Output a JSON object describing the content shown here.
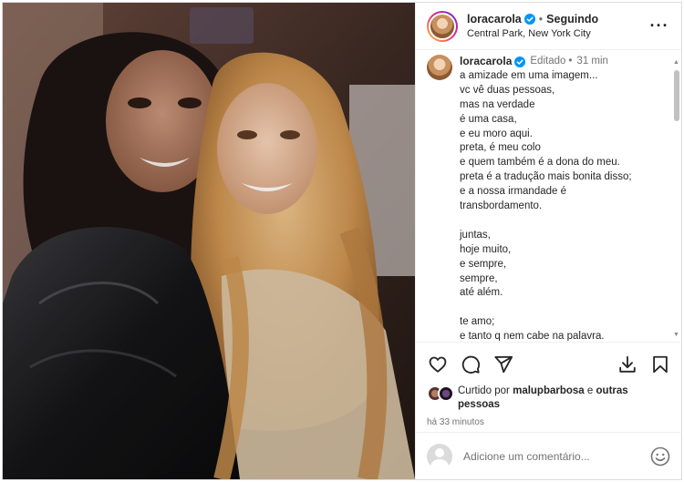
{
  "post": {
    "username": "loracarola",
    "follow_status": "Seguindo",
    "separator": "•",
    "location": "Central Park, New York City",
    "more_label": "···"
  },
  "caption": {
    "username": "loracarola",
    "edited_label": "Editado",
    "separator": "•",
    "time": "31 min",
    "lines": [
      "a amizade em uma imagem...",
      "vc vê duas pessoas,",
      "mas na verdade",
      "é uma casa,",
      "e eu moro aqui.",
      "preta, é meu colo",
      "e quem também é a dona do meu.",
      "preta é a tradução mais bonita disso;",
      "e a nossa irmandade é",
      "transbordamento.",
      "",
      "juntas,",
      "hoje muito,",
      "e sempre,",
      "sempre,",
      "até além.",
      "",
      "te amo;",
      "e tanto q nem cabe na palavra."
    ]
  },
  "likes": {
    "prefix": "Curtido por",
    "user": "malupbarbosa",
    "joiner": "e",
    "suffix": "outras pessoas"
  },
  "timestamp": "há 33 minutos",
  "comment": {
    "placeholder": "Adicione um comentário..."
  },
  "colors": {
    "verified": "#0095f6",
    "text": "#262626",
    "secondary": "#737373",
    "border": "#dbdbdb"
  },
  "icons": {
    "like": "heart-icon",
    "comment": "comment-icon",
    "share": "send-icon",
    "download": "download-icon",
    "save": "bookmark-icon",
    "emoji": "smiley-icon"
  }
}
